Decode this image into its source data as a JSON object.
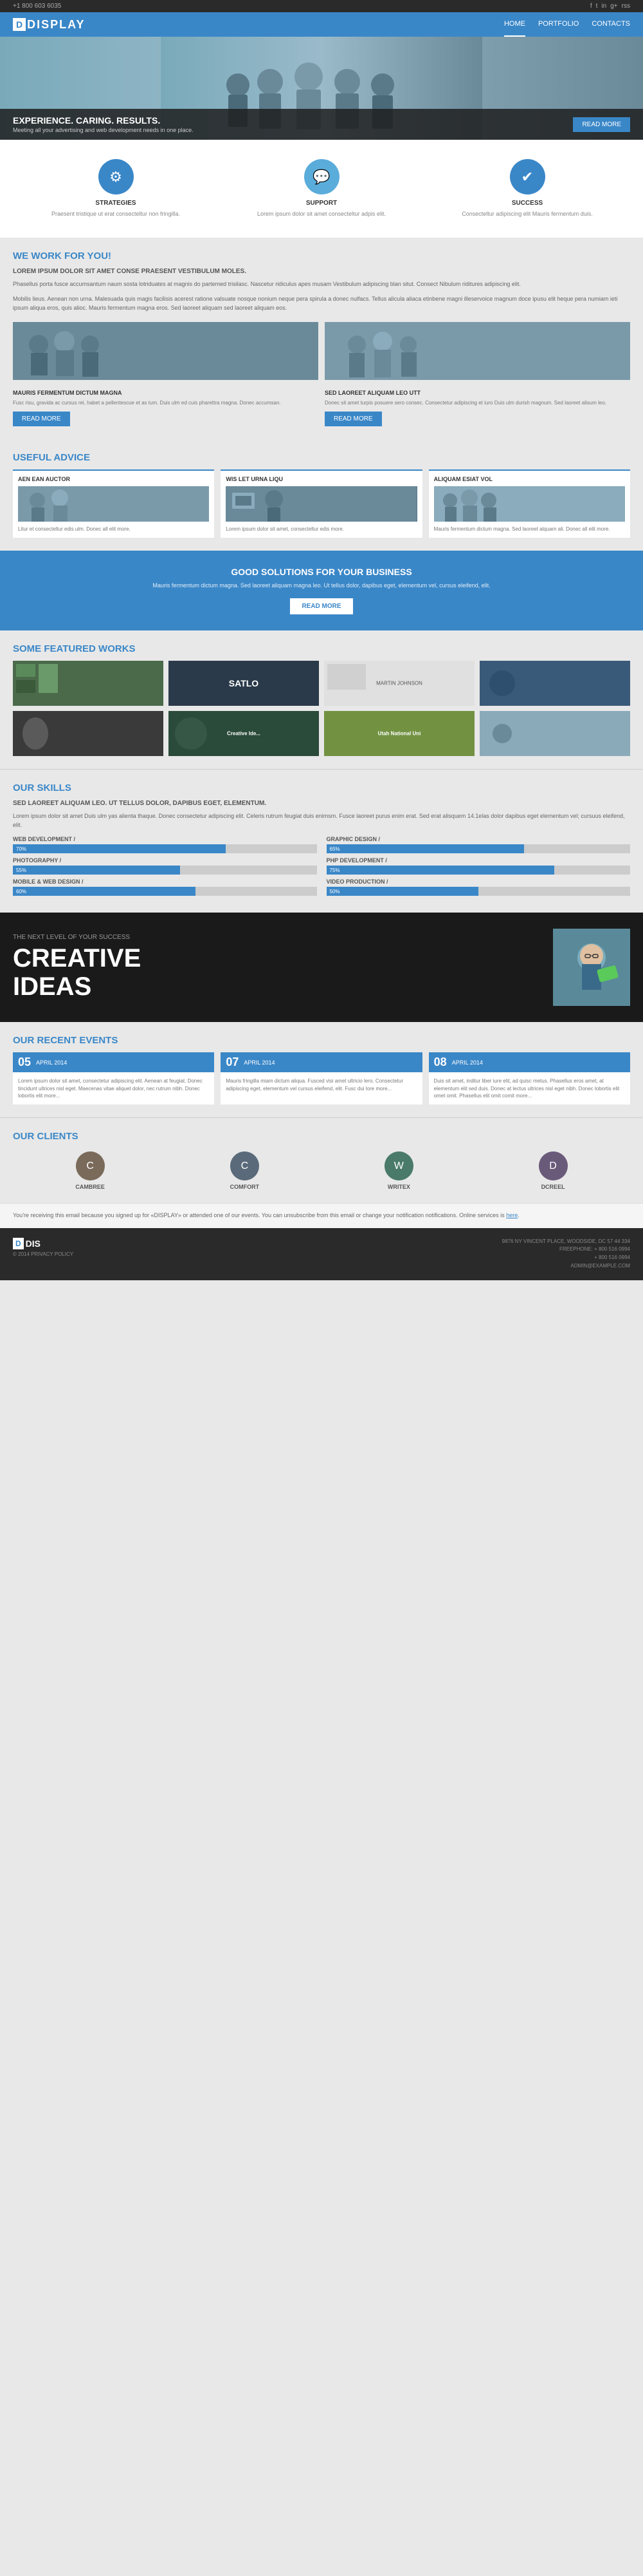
{
  "topbar": {
    "phone": "+1 800 603 6035",
    "social_icons": [
      "f",
      "t",
      "in",
      "g+",
      "rss"
    ]
  },
  "nav": {
    "logo_letter": "D",
    "logo_name": "DISPLAY",
    "links": [
      {
        "label": "HOME",
        "active": true
      },
      {
        "label": "PORTFOLIO",
        "active": false
      },
      {
        "label": "CONTACTS",
        "active": false
      }
    ]
  },
  "hero": {
    "title": "EXPERIENCE. CARING. RESULTS.",
    "subtitle": "Meeting all your advertising and web development needs in one place.",
    "cta": "READ MORE"
  },
  "icons_row": {
    "items": [
      {
        "icon": "⚙",
        "label": "STRATEGIES",
        "desc": "Praesent tristique ut erat consecteltur non fringilla."
      },
      {
        "icon": "💬",
        "label": "SUPPORT",
        "desc": "Lorem ipsum dolor sit amet consecteltur adpis elit."
      },
      {
        "icon": "✔",
        "label": "SUCCESS",
        "desc": "Consecteltur adipiscing elit Mauris fermentum duis."
      }
    ]
  },
  "we_work": {
    "title": "WE WORK FOR YOU!",
    "subtitle": "LOREM IPSUM DOLOR SIT AMET CONSE PRAESENT VESTIBULUM MOLES.",
    "para1": "Phasellus porta fusce accumsantum naum sosta lotriduates at magnis do partemed trisilasc. Nascetur ridiculus apes musam Vestibulum adipiscing blan situt. Consect Nibulum riditures adipiscing elit.",
    "para2": "Mobilis lieus. Aenean non urna. Malesuada quis magis facilisis acerest ratione valsuate nosque nonium neque pera spirula a donec nulfacs. Tellus alicula aliaca etinbene magni illeservoice magnum doce ipusu elit heque pera numiam ieti ipsum aliqua eros, quis alioc. Mauris fermentum magna eros. Sed laoreet aliquam sed laoreet aliquam eos.",
    "col1_title": "MAURIS FERMENTUM DICTUM MAGNA",
    "col1_text": "Fusc risu, gravida ac cursus rei, habet a pellentescue et as tum. Duis ulm ed cuis pharettra magna. Donec accumsan.",
    "col2_title": "SED LAOREET ALIQUAM LEO UTT",
    "col2_text": "Donec sit amet turpis posuere sero consec. Consectetur adipiscing et iuro Duis ulm durish magnum. Sed laoreet alisum leo.",
    "read_more": "READ MORE"
  },
  "useful_advice": {
    "title": "USEFUL ADVICE",
    "items": [
      {
        "tag": "AEN EAN AUCTOR",
        "text": "Litur et consecteltur edis ulm. Donec all elit more."
      },
      {
        "tag": "WIS LET URNA LIQU",
        "text": "Lorem ipsum dolor sit amet, consecteltur edis more."
      },
      {
        "tag": "ALIQUAM ESIAT VOL",
        "text": "Mauris fermentum dictum magna. Sed laoreet alquam ali. Donec all elit more."
      }
    ]
  },
  "good_solutions": {
    "title": "GOOD SOLUTIONS FOR YOUR BUSINESS",
    "subtitle": "Mauris fermentum dictum magna. Sed laoreet aliquam magna leo. Ut tellus dolor, dapibus eget, elementum vel, cursus eleifend, elit.",
    "cta": "READ MORE"
  },
  "featured_works": {
    "title": "SOME FEATURED WORKS",
    "items": [
      {
        "label": "",
        "type": "wt1"
      },
      {
        "label": "SATLO",
        "type": "wt2"
      },
      {
        "label": "MARTIN JOHNSON",
        "type": "wt3"
      },
      {
        "label": "",
        "type": "wt4"
      },
      {
        "label": "",
        "type": "wt5"
      },
      {
        "label": "Creative Ide...",
        "type": "wt6"
      },
      {
        "label": "Utah National Uni",
        "type": "wt7"
      },
      {
        "label": "",
        "type": "wt8"
      }
    ]
  },
  "skills": {
    "title": "OUR SKILLS",
    "subtitle": "SED LAOREET ALIQUAM LEO. UT TELLUS DOLOR, DAPIBUS EGET, ELEMENTUM.",
    "desc": "Lorem ipsum dolor sit amet Duis ulm yas alienta thaque. Donec consectetur adipiscing elit. Celeris rutrum feugiat duis enimsm. Fusce laoreet purus enim erat. Sed erat alisquem 14.1elas dolor dapibus eget elementum vel; cursuus eleifend, elit.",
    "left_bars": [
      {
        "label": "WEB DEVELOPMENT /",
        "pct": 70
      },
      {
        "label": "PHOTOGRAPHY /",
        "pct": 55
      },
      {
        "label": "MOBILE & WEB DESIGN /",
        "pct": 60
      }
    ],
    "right_bars": [
      {
        "label": "GRAPHIC DESIGN /",
        "pct": 65
      },
      {
        "label": "PHP DEVELOPMENT /",
        "pct": 75
      },
      {
        "label": "VIDEO PRODUCTION /",
        "pct": 50
      }
    ]
  },
  "creative": {
    "tagline": "THE NEXT LEVEL OF YOUR SUCCESS",
    "title_line1": "CREATIVE",
    "title_line2": "IDEAS"
  },
  "recent_events": {
    "title": "OUR RECENT EVENTS",
    "items": [
      {
        "day": "05",
        "month": "APRIL 2014",
        "title": "Lorem ipsum dolor",
        "text": "Lorem ipsum dolor sit amet, consectetur adipiscing elit. Aenean at feugiat. Donec tincidunt ultrices nisl eget. Maecenas vitae aliquet dolor, nec rutrum nibh. Donec lobortis elit more..."
      },
      {
        "day": "07",
        "month": "APRIL 2014",
        "title": "Mauris fringilla",
        "text": "Mauris fringilla miam dictum aliqua. Fusced visi amet ultricio lero. Consectetur adipiscing eget, elementum vel cursus eleifend, elit. Fusc dui lore more..."
      },
      {
        "day": "08",
        "month": "APRIL 2014",
        "title": "Duis sit amet",
        "text": "Duis sit amet, inditur liber iure elit, ad quisc metus. Phasellus eros amet, at elementum elit sed duis. Donec at lectus ultrices nisl eget nibh. Donec lobortis elit omet omit. Phasellus elit omit comit more..."
      }
    ]
  },
  "clients": {
    "title": "OUR CLIENTS",
    "items": [
      {
        "name": "CAMBREE",
        "icon": "C"
      },
      {
        "name": "COMFORT",
        "icon": "C"
      },
      {
        "name": "WRITEX",
        "icon": "W"
      },
      {
        "name": "DCREEL",
        "icon": "D"
      }
    ]
  },
  "footer_email": {
    "text": "You're receiving this email because you signed up for «DISPLAY» or attended one of our events. You can unsubscribe from this email or change your notification notifications. Online services is",
    "link_text": "here"
  },
  "footer": {
    "logo_letter": "D",
    "logo_name": "DIS",
    "copyright": "© 2014 PRIVACY POLICY",
    "address": "9876 NY VINCENT PLACE, WOODSIDE, DC 57 44 334",
    "phone1": "FREEPHONE: + 800 516 0994",
    "phone2": "+ 800 516 0994",
    "email": "ADMIN@EXAMPLE.COM"
  }
}
